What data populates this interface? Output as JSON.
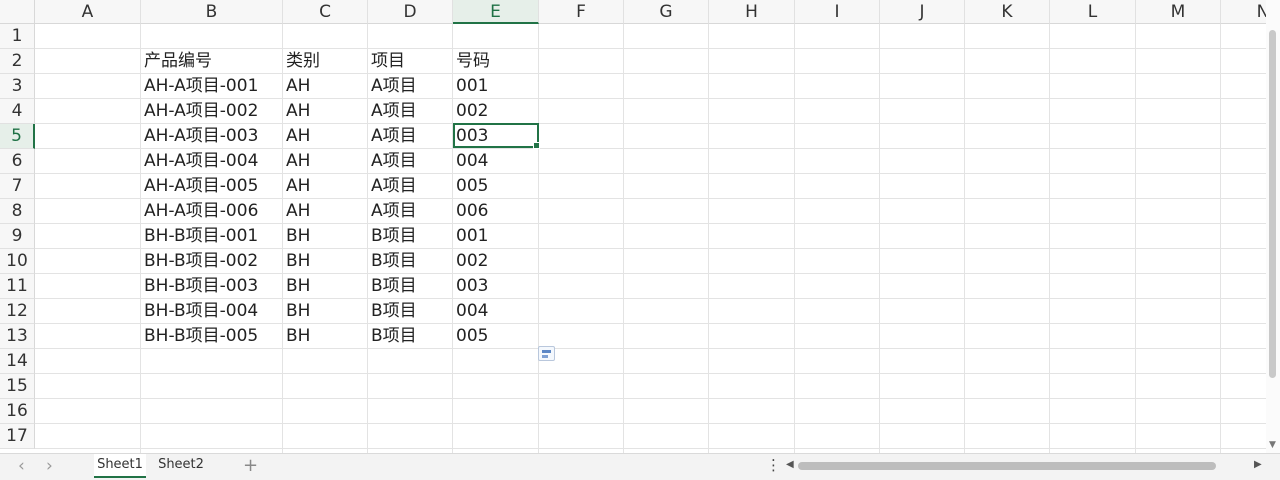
{
  "columns": [
    "A",
    "B",
    "C",
    "D",
    "E",
    "F",
    "G",
    "H",
    "I",
    "J",
    "K",
    "L",
    "M",
    "N"
  ],
  "rows": [
    "1",
    "2",
    "3",
    "4",
    "5",
    "6",
    "7",
    "8",
    "9",
    "10",
    "11",
    "12",
    "13",
    "14",
    "15",
    "16",
    "17"
  ],
  "active_cell": {
    "column": "E",
    "row": "5"
  },
  "cells": {
    "headers": {
      "b": "产品编号",
      "c": "类别",
      "d": "项目",
      "e": "号码"
    },
    "data": [
      {
        "b": "AH-A项目-001",
        "c": "AH",
        "d": "A项目",
        "e": "001"
      },
      {
        "b": "AH-A项目-002",
        "c": "AH",
        "d": "A项目",
        "e": "002"
      },
      {
        "b": "AH-A项目-003",
        "c": "AH",
        "d": "A项目",
        "e": "003"
      },
      {
        "b": "AH-A项目-004",
        "c": "AH",
        "d": "A项目",
        "e": "004"
      },
      {
        "b": "AH-A项目-005",
        "c": "AH",
        "d": "A项目",
        "e": "005"
      },
      {
        "b": "AH-A项目-006",
        "c": "AH",
        "d": "A项目",
        "e": "006"
      },
      {
        "b": "BH-B项目-001",
        "c": "BH",
        "d": "B项目",
        "e": "001"
      },
      {
        "b": "BH-B项目-002",
        "c": "BH",
        "d": "B项目",
        "e": "002"
      },
      {
        "b": "BH-B项目-003",
        "c": "BH",
        "d": "B项目",
        "e": "003"
      },
      {
        "b": "BH-B项目-004",
        "c": "BH",
        "d": "B项目",
        "e": "004"
      },
      {
        "b": "BH-B项目-005",
        "c": "BH",
        "d": "B项目",
        "e": "005"
      }
    ]
  },
  "sheet_tabs": [
    "Sheet1",
    "Sheet2"
  ],
  "active_sheet": "Sheet1",
  "icons": {
    "nav_prev": "chevron-left-icon",
    "nav_next": "chevron-right-icon",
    "add": "plus-icon",
    "menu": "more-vertical-icon",
    "paste": "paste-options-icon"
  },
  "glyphs": {
    "prev": "‹",
    "next": "›",
    "add": "+",
    "menu": "⋮",
    "left": "◀",
    "right": "▶",
    "down": "▼"
  },
  "colors": {
    "accent": "#217346",
    "header_bg": "#f7f7f7",
    "gridline": "#e3e3e3"
  }
}
